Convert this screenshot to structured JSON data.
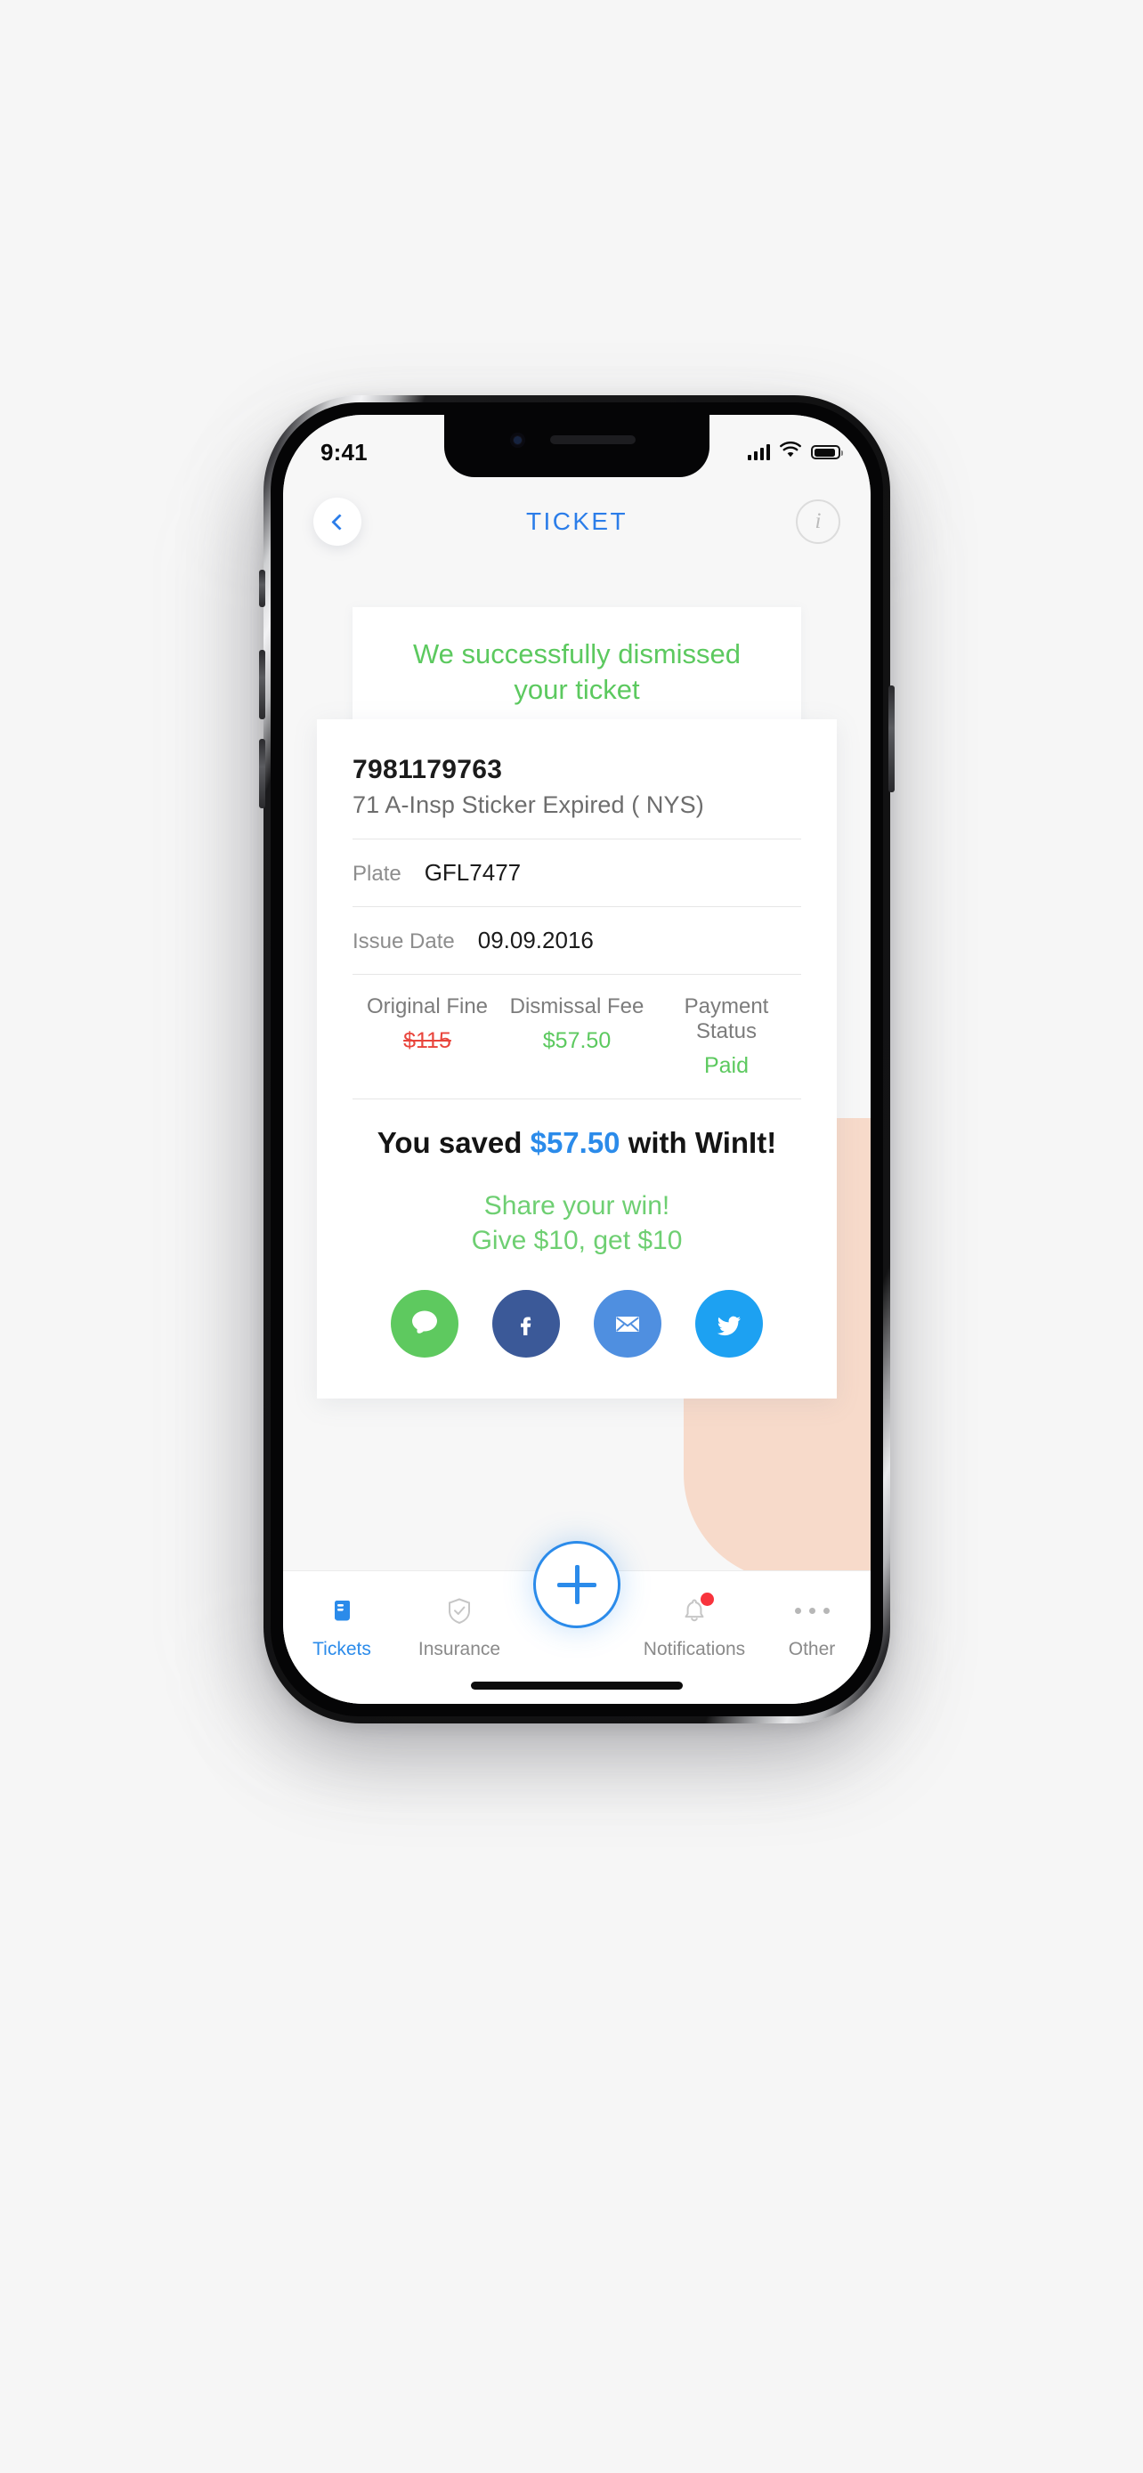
{
  "status_bar": {
    "time": "9:41",
    "signal_icon": "cellular-signal-icon",
    "wifi_icon": "wifi-icon",
    "battery_icon": "battery-icon"
  },
  "header": {
    "back_icon": "chevron-left-icon",
    "title": "TICKET",
    "info_icon": "info-icon",
    "info_label": "i"
  },
  "banner": {
    "message": "We successfully dismissed\nyour ticket",
    "color": "#5cc95f"
  },
  "ticket": {
    "number": "7981179763",
    "description": "71 A-Insp Sticker Expired ( NYS)",
    "plate_label": "Plate",
    "plate_value": "GFL7477",
    "issue_date_label": "Issue Date",
    "issue_date_value": "09.09.2016",
    "fees": [
      {
        "label": "Original Fine",
        "value": "$115",
        "style": "struck"
      },
      {
        "label": "Dismissal Fee",
        "value": "$57.50",
        "style": "green"
      },
      {
        "label": "Payment Status",
        "value": "Paid",
        "style": "green"
      }
    ],
    "saved_prefix": "You saved ",
    "saved_amount": "$57.50",
    "saved_suffix": " with WinIt!"
  },
  "share": {
    "headline": "Share your win!\nGive $10, get $10",
    "buttons": [
      {
        "name": "sms",
        "icon": "message-bubble-icon",
        "color": "#5ec95f"
      },
      {
        "name": "facebook",
        "icon": "facebook-icon",
        "color": "#3b5998"
      },
      {
        "name": "email",
        "icon": "envelope-icon",
        "color": "#4f8fe0"
      },
      {
        "name": "twitter",
        "icon": "twitter-bird-icon",
        "color": "#1da1f2"
      }
    ]
  },
  "tabbar": {
    "items": [
      {
        "label": "Tickets",
        "icon": "receipt-scroll-icon",
        "active": true,
        "badge": false
      },
      {
        "label": "Insurance",
        "icon": "shield-check-icon",
        "active": false,
        "badge": false
      },
      {
        "label": "Notifications",
        "icon": "bell-icon",
        "active": false,
        "badge": true
      },
      {
        "label": "Other",
        "icon": "ellipsis-icon",
        "active": false,
        "badge": false
      }
    ],
    "fab_icon": "plus-icon",
    "accent_color": "#2b8bea"
  }
}
